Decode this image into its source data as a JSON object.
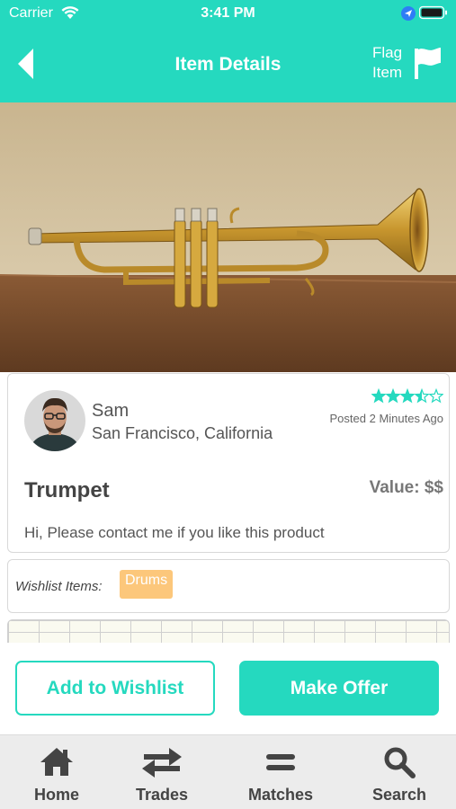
{
  "status_bar": {
    "carrier": "Carrier",
    "time": "3:41 PM"
  },
  "nav": {
    "title": "Item Details",
    "flag_line1": "Flag",
    "flag_line2": "Item"
  },
  "seller": {
    "name": "Sam",
    "location": "San Francisco, California",
    "rating": 3.5,
    "rating_max": 5,
    "posted": "Posted 2 Minutes Ago"
  },
  "item": {
    "title": "Trumpet",
    "value": "Value: $$",
    "description": "Hi, Please contact me if you like this product"
  },
  "wishlist": {
    "label": "Wishlist Items:",
    "tags": [
      "Drums"
    ]
  },
  "actions": {
    "add_wishlist": "Add to Wishlist",
    "make_offer": "Make Offer"
  },
  "tabs": [
    {
      "label": "Home",
      "icon": "home-icon"
    },
    {
      "label": "Trades",
      "icon": "trades-icon"
    },
    {
      "label": "Matches",
      "icon": "matches-icon"
    },
    {
      "label": "Search",
      "icon": "search-icon"
    }
  ],
  "colors": {
    "accent": "#25d9bf",
    "tag": "#fcc77b",
    "tab_bg": "#ececec"
  }
}
